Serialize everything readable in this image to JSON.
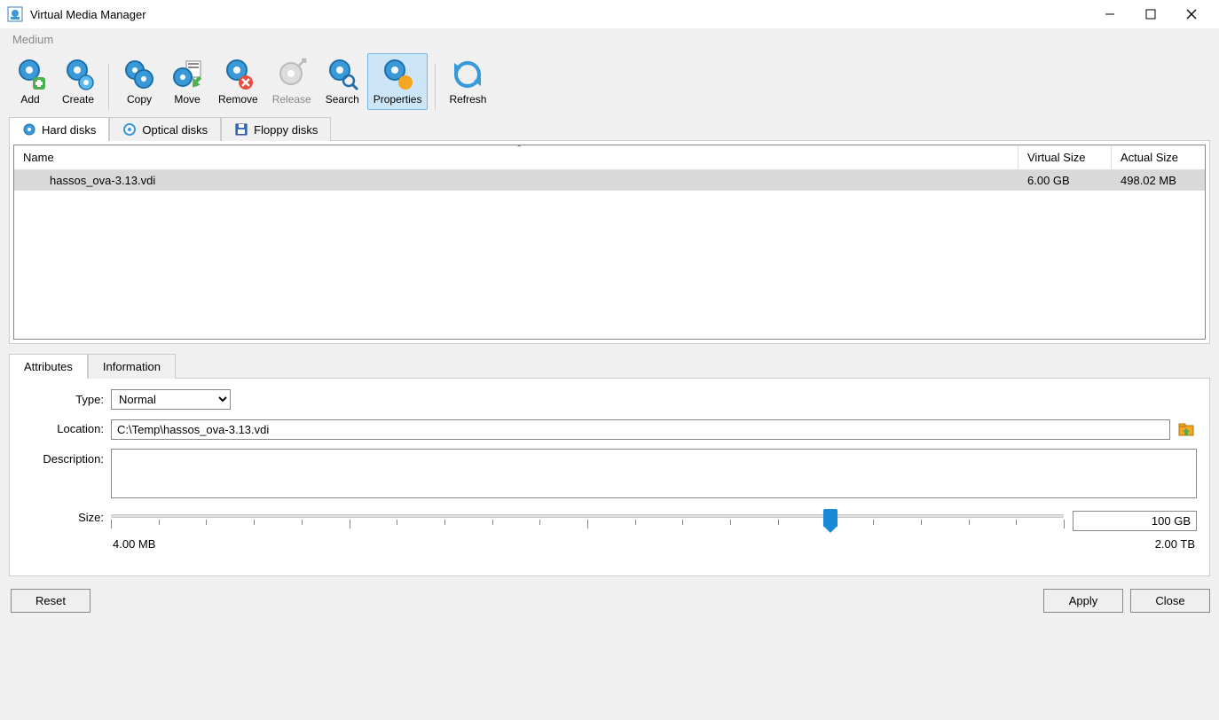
{
  "window": {
    "title": "Virtual Media Manager"
  },
  "menu": {
    "medium": "Medium"
  },
  "toolbar": {
    "add": "Add",
    "create": "Create",
    "copy": "Copy",
    "move": "Move",
    "remove": "Remove",
    "release": "Release",
    "search": "Search",
    "properties": "Properties",
    "refresh": "Refresh"
  },
  "tabs": {
    "hard": "Hard disks",
    "optical": "Optical disks",
    "floppy": "Floppy disks"
  },
  "table": {
    "headers": {
      "name": "Name",
      "vsize": "Virtual Size",
      "asize": "Actual Size"
    },
    "rows": [
      {
        "name": "hassos_ova-3.13.vdi",
        "vsize": "6.00 GB",
        "asize": "498.02 MB"
      }
    ]
  },
  "attrTabs": {
    "attributes": "Attributes",
    "information": "Information"
  },
  "form": {
    "type_label": "Type:",
    "type_value": "Normal",
    "location_label": "Location:",
    "location_value": "C:\\Temp\\hassos_ova-3.13.vdi",
    "description_label": "Description:",
    "description_value": "",
    "size_label": "Size:",
    "size_value": "100 GB",
    "scale_min": "4.00 MB",
    "scale_max": "2.00 TB",
    "slider_percent": 75.5
  },
  "buttons": {
    "reset": "Reset",
    "apply": "Apply",
    "close": "Close"
  }
}
